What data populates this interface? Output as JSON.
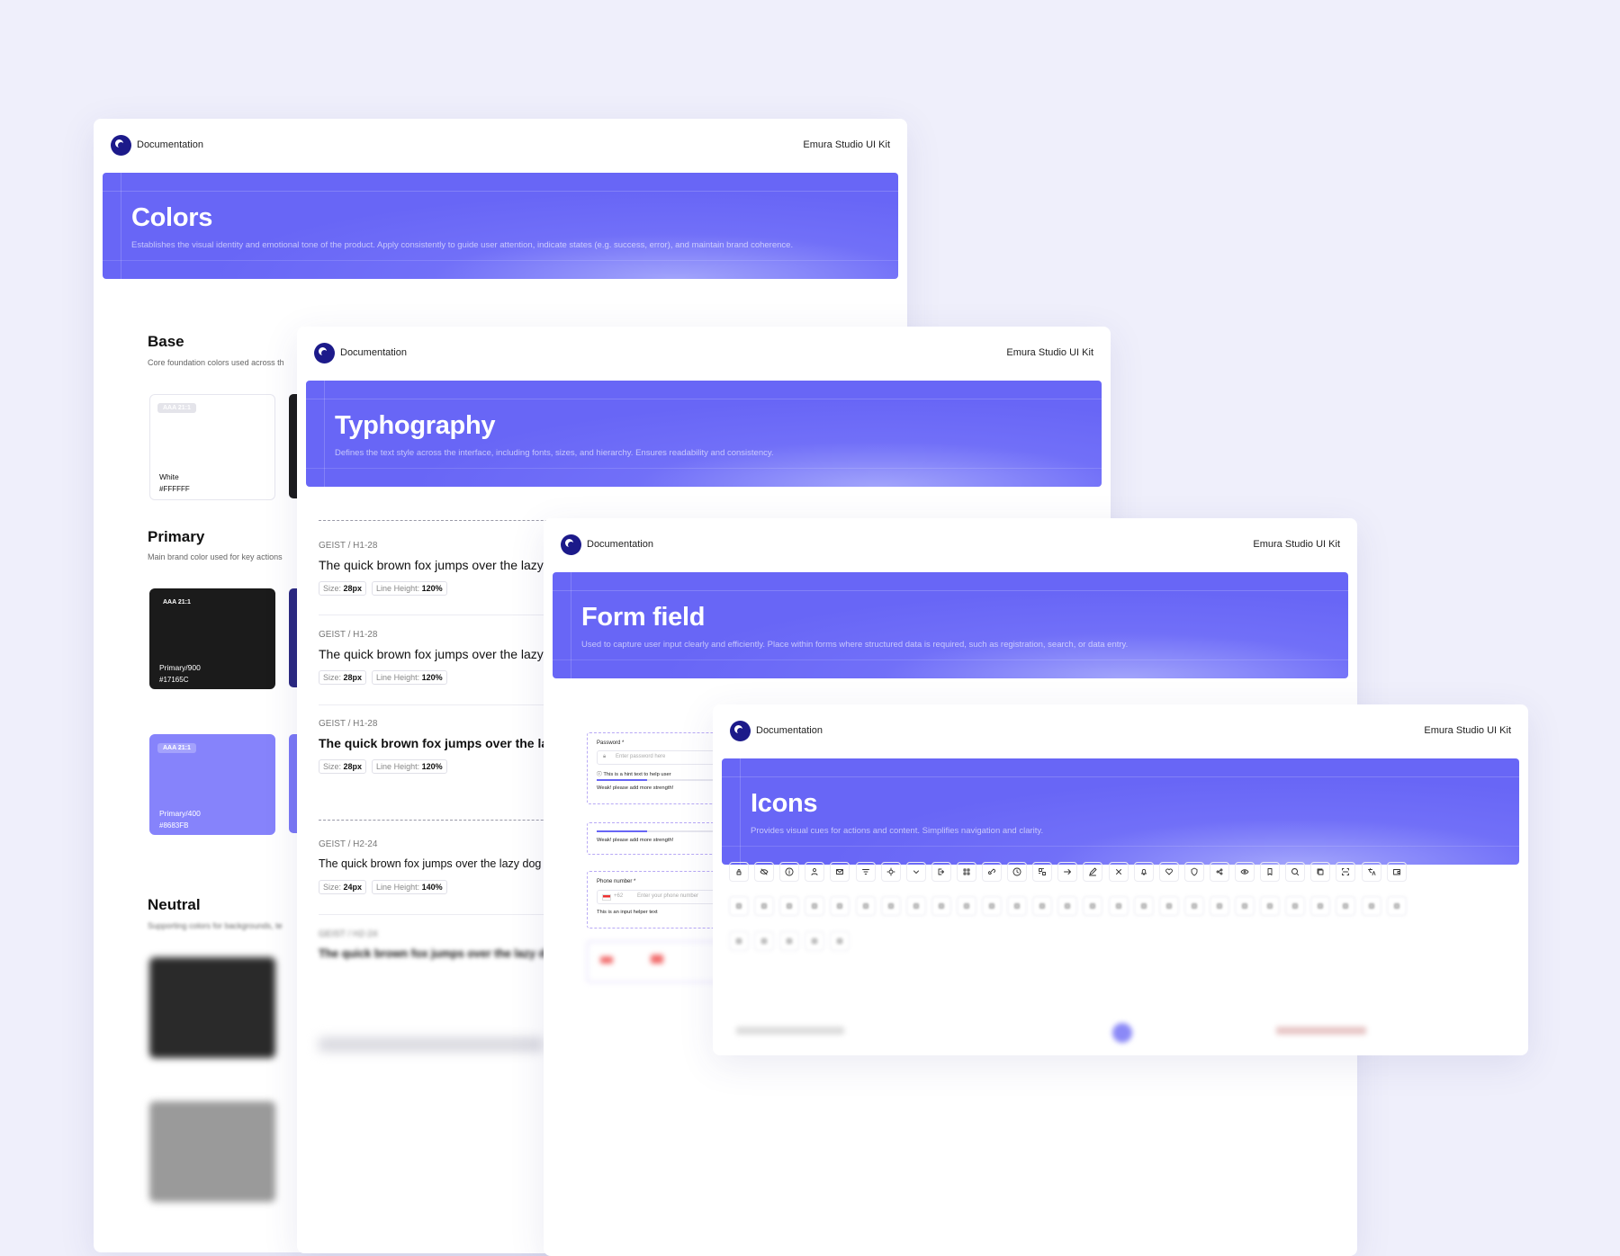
{
  "common": {
    "documentation": "Documentation",
    "kit": "Emura Studio UI Kit"
  },
  "colors_page": {
    "title": "Colors",
    "description": "Establishes the visual identity and emotional tone of the product. Apply consistently to guide user attention, indicate states (e.g. success, error), and maintain brand coherence.",
    "base": {
      "title": "Base",
      "subtitle": "Core foundation colors used across th",
      "white_badge": "AAA 21:1",
      "white_name": "White",
      "white_hex": "#FFFFFF"
    },
    "primary": {
      "title": "Primary",
      "subtitle": "Main brand color used for key actions",
      "p900_badge": "AAA 21:1",
      "p900_name": "Primary/900",
      "p900_hex": "#17165C",
      "p400_badge": "AAA 21:1",
      "p400_name": "Primary/400",
      "p400_hex": "#8683FB"
    },
    "neutral": {
      "title": "Neutral",
      "subtitle": "Supporting colors for backgrounds, te"
    },
    "swatch_colors": {
      "white": "#FFFFFF",
      "primary900": "#17165C",
      "primary400": "#8683FB",
      "accent": "#6866F6"
    }
  },
  "typography_page": {
    "title": "Typhography",
    "description": "Defines the text style across the interface, including fonts, sizes, and hierarchy. Ensures readability and consistency.",
    "samples": [
      {
        "label": "GEIST / H1-28",
        "text": "The quick brown fox jumps over the lazy dog",
        "size_label": "Size:",
        "size": "28px",
        "lh_label": "Line Height:",
        "lh": "120%"
      },
      {
        "label": "GEIST / H1-28",
        "text": "The quick brown fox jumps over the lazy dog",
        "size_label": "Size:",
        "size": "28px",
        "lh_label": "Line Height:",
        "lh": "120%"
      },
      {
        "label": "GEIST / H1-28",
        "text": "The quick brown fox jumps over the lazy dog",
        "size_label": "Size:",
        "size": "28px",
        "lh_label": "Line Height:",
        "lh": "120%"
      },
      {
        "label": "GEIST / H2-24",
        "text": "The quick brown fox jumps over the lazy dog",
        "size_label": "Size:",
        "size": "24px",
        "lh_label": "Line Height:",
        "lh": "140%"
      },
      {
        "label": "GEIST / H2-24",
        "text": "The quick brown fox jumps over the lazy dog"
      }
    ]
  },
  "form_page": {
    "title": "Form field",
    "description": "Used to capture user input clearly and efficiently. Place within forms where structured data is required, such as registration, search, or data entry.",
    "password": {
      "label": "Password *",
      "placeholder": "Enter password here",
      "hint": "This is a hint text to help user",
      "strength": "Weak! please add more strength!"
    },
    "strength2": "Weak! please add more strength!",
    "phone": {
      "label": "Phone number *",
      "code": "+62",
      "placeholder": "Enter your phone number",
      "helper": "This is an input helper text"
    }
  },
  "icons_page": {
    "title": "Icons",
    "description": "Provides visual cues for actions and content. Simplifies navigation and clarity.",
    "row1": [
      "lock-icon",
      "eye-off-icon",
      "info-icon",
      "user-icon",
      "mail-icon",
      "filter-icon",
      "settings-icon",
      "chevron-down-icon",
      "logout-icon",
      "grid-icon",
      "link-icon",
      "clock-icon",
      "qr-icon",
      "arrow-right-icon",
      "edit-icon",
      "close-icon",
      "bell-icon",
      "heart-icon",
      "shield-icon",
      "share-icon",
      "eye-icon",
      "bookmark-icon",
      "search-icon",
      "copy-icon",
      "scan-icon",
      "translate-icon",
      "wallet-icon"
    ],
    "row2_count": 27,
    "row3_count": 5
  }
}
